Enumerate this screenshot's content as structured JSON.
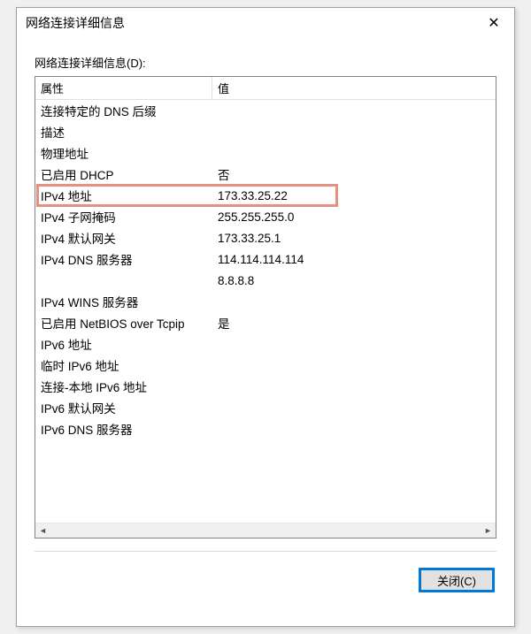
{
  "dialog": {
    "title": "网络连接详细信息",
    "section_label": "网络连接详细信息(D):",
    "columns": {
      "property": "属性",
      "value": "值"
    },
    "rows": [
      {
        "prop": "连接特定的 DNS 后缀",
        "val": ""
      },
      {
        "prop": "描述",
        "val": ""
      },
      {
        "prop": "物理地址",
        "val": ""
      },
      {
        "prop": "已启用 DHCP",
        "val": "否"
      },
      {
        "prop": "IPv4 地址",
        "val": "173.33.25.22",
        "highlight": true
      },
      {
        "prop": "IPv4 子网掩码",
        "val": "255.255.255.0"
      },
      {
        "prop": "IPv4 默认网关",
        "val": "173.33.25.1"
      },
      {
        "prop": "IPv4 DNS 服务器",
        "val": "114.114.114.114"
      },
      {
        "prop": "",
        "val": "8.8.8.8"
      },
      {
        "prop": "IPv4 WINS 服务器",
        "val": ""
      },
      {
        "prop": "已启用 NetBIOS over Tcpip",
        "val": "是"
      },
      {
        "prop": "IPv6 地址",
        "val": ""
      },
      {
        "prop": "临时 IPv6 地址",
        "val": ""
      },
      {
        "prop": "连接-本地 IPv6 地址",
        "val": ""
      },
      {
        "prop": "IPv6 默认网关",
        "val": ""
      },
      {
        "prop": "IPv6 DNS 服务器",
        "val": ""
      }
    ],
    "close_button": "关闭(C)"
  }
}
